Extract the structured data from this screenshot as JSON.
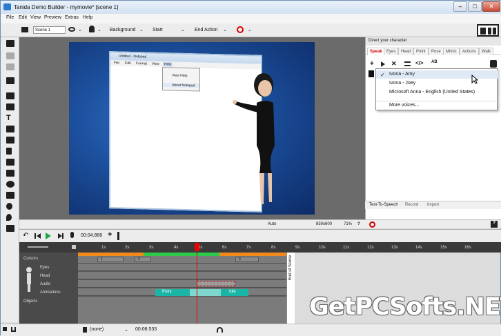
{
  "window": {
    "title": "Tanida Demo Builder - mymovie* [scene 1]",
    "controls": {
      "minimize": "–",
      "maximize": "□",
      "close": "✕"
    }
  },
  "menu": [
    "File",
    "Edit",
    "View",
    "Preview",
    "Extras",
    "Help"
  ],
  "toolbar": {
    "scene_value": "Scene 1",
    "background_label": "Background",
    "start_label": "Start",
    "end_action_label": "End Action"
  },
  "stage": {
    "notepad_title": "Untitled - Notepad",
    "notepad_menu": [
      "File",
      "Edit",
      "Format",
      "View",
      "Help"
    ],
    "notepad_dropdown": [
      "View Help",
      "About Notepad"
    ]
  },
  "stage_status": {
    "auto": "Auto",
    "resolution": "850x600",
    "zoom": "71%",
    "help": "?"
  },
  "right_panel": {
    "header": "Direct your character",
    "tabs": [
      "Speak",
      "Eyes",
      "Head",
      "Point",
      "Pose",
      "Mimic",
      "Actions",
      "Walk"
    ],
    "active_tab": "Speak",
    "voice_menu": {
      "items": [
        "Ivona - Amy",
        "Ivona - Joey",
        "Microsoft Anna - English (United States)",
        "More voices..."
      ],
      "checked": "Ivona - Amy",
      "check_mark": "✓"
    },
    "bottom_tabs": [
      "Text-To-Speech",
      "Record",
      "Import"
    ],
    "status_help": "?"
  },
  "timeline": {
    "time": "00:04.866",
    "ticks": [
      "1s",
      "2s",
      "3s",
      "4s",
      "5s",
      "6s",
      "7s",
      "8s",
      "9s",
      "10s",
      "11s",
      "12s",
      "13s",
      "14s",
      "15s",
      "16s"
    ],
    "rows": [
      "Cursors",
      "Eyes",
      "Head",
      "Audio",
      "Animations",
      "Objects"
    ],
    "cursor_labels": [
      "1",
      "2",
      "3"
    ],
    "animation_labels": [
      "Point",
      "Idle"
    ],
    "end_of_scene": "End of Scene",
    "bottom_select": "(none)",
    "bottom_time": "00:08.533"
  },
  "watermark": "GetPCSofts.NET",
  "colors": {
    "accent_red": "#cc0000",
    "timeline_green": "#2ec84a",
    "timeline_orange": "#f08a1c",
    "animation_teal": "#1bb5a6"
  }
}
